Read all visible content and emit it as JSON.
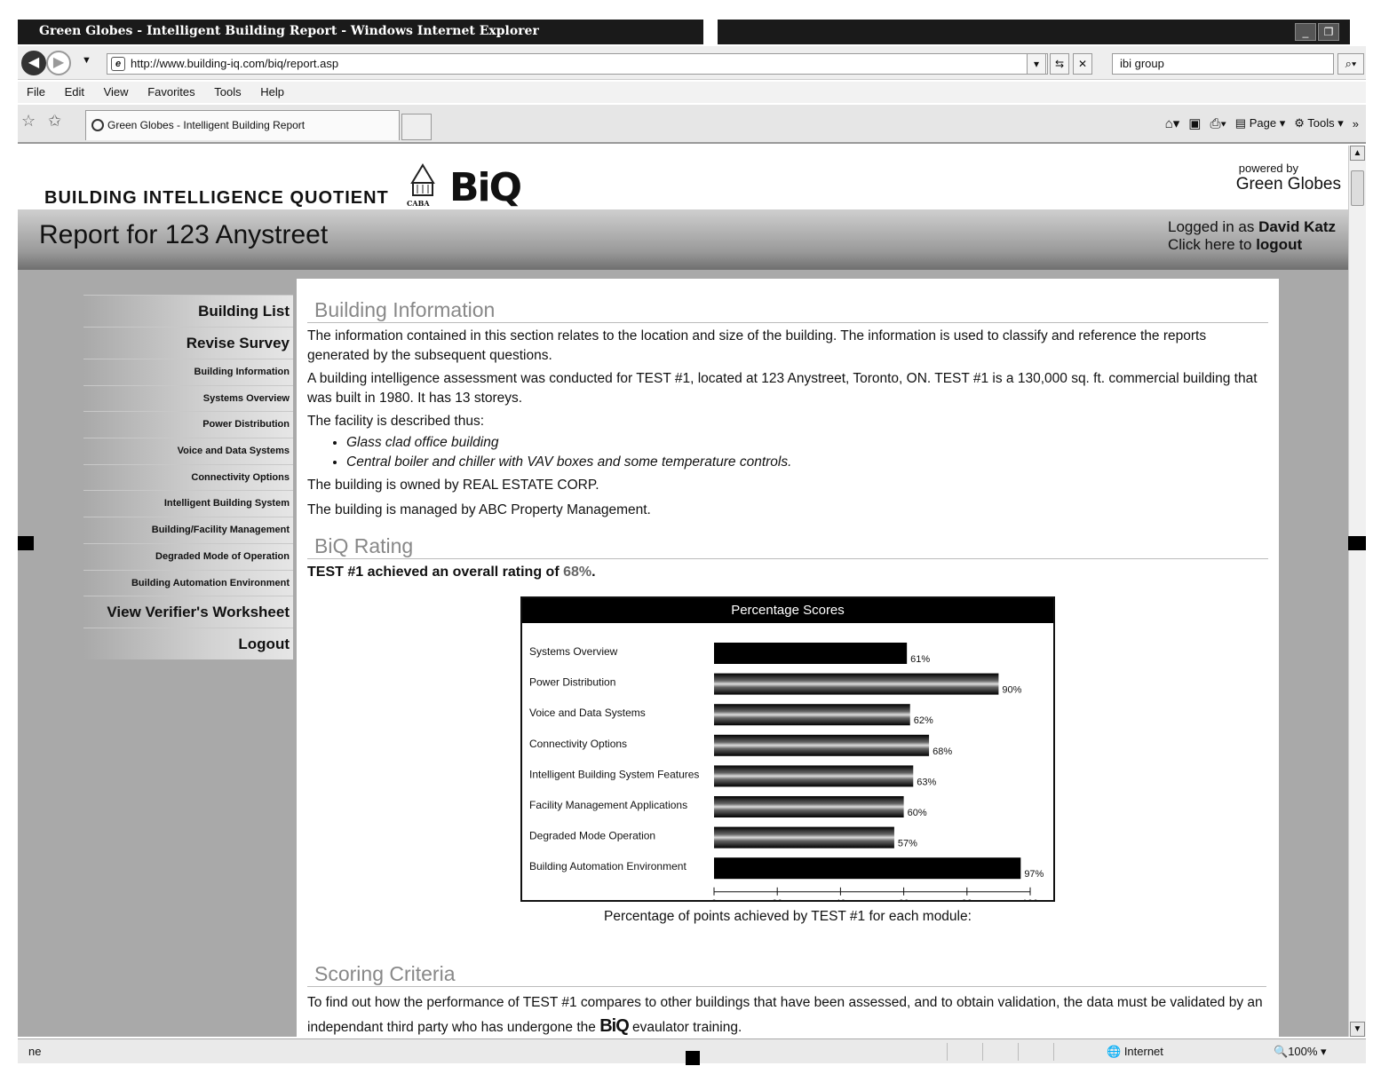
{
  "window": {
    "title": "Green Globes - Intelligent Building Report - Windows Internet Explorer",
    "min_label": "_",
    "max_label": "❐"
  },
  "address": {
    "url": "http://www.building-iq.com/biq/report.asp",
    "search_value": "ibi group"
  },
  "menu": [
    "File",
    "Edit",
    "View",
    "Favorites",
    "Tools",
    "Help"
  ],
  "tab": {
    "label": "Green Globes - Intelligent Building Report"
  },
  "commandbar": {
    "page": "Page",
    "tools": "Tools"
  },
  "brand": {
    "name": "BUILDING INTELLIGENCE QUOTIENT",
    "logo": "BiQ",
    "caba": "CABA",
    "powered_by": "powered by",
    "powered_name": "Green Globes"
  },
  "report": {
    "title": "Report for 123 Anystreet",
    "logged_in_prefix": "Logged in as ",
    "user": "David Katz",
    "logout_prefix": "Click here to ",
    "logout_link": "logout"
  },
  "sidebar": {
    "main_top": [
      "Building List",
      "Revise Survey"
    ],
    "sub": [
      "Building Information",
      "Systems Overview",
      "Power Distribution",
      "Voice and Data Systems",
      "Connectivity Options",
      "Intelligent Building System",
      "Building/Facility Management",
      "Degraded Mode of Operation",
      "Building Automation Environment"
    ],
    "main_bottom": [
      "View Verifier's Worksheet",
      "Logout"
    ]
  },
  "building_info": {
    "heading": "Building Information",
    "p1": "The information contained in this section relates to the location and size of the building. The information is used to classify and reference the reports generated by the subsequent questions.",
    "p2": "A building intelligence assessment was conducted for TEST #1, located at 123 Anystreet, Toronto, ON. TEST #1 is a 130,000 sq. ft. commercial building that was built in 1980. It has 13 storeys.",
    "p3": "The facility is described thus:",
    "bullets": [
      "Glass clad office building",
      "Central boiler and chiller with VAV boxes and some temperature controls."
    ],
    "owner": "The building is owned by REAL ESTATE CORP.",
    "manager": "The building is managed by ABC Property Management."
  },
  "biq_rating": {
    "heading": "BiQ Rating",
    "summary_prefix": "TEST #1 achieved an overall rating of ",
    "summary_pct": "68%",
    "summary_suffix": ".",
    "caption": "Percentage of points achieved by TEST #1 for each module:"
  },
  "chart_data": {
    "type": "bar",
    "orientation": "horizontal",
    "title": "Percentage Scores",
    "categories": [
      "Systems Overview",
      "Power Distribution",
      "Voice and Data Systems",
      "Connectivity Options",
      "Intelligent Building System Features",
      "Facility Management Applications",
      "Degraded Mode Operation",
      "Building Automation Environment"
    ],
    "values": [
      61,
      90,
      62,
      68,
      63,
      60,
      57,
      97
    ],
    "value_labels": [
      "61%",
      "90%",
      "62%",
      "68%",
      "63%",
      "60%",
      "57%",
      "97%"
    ],
    "xlim": [
      0,
      100
    ],
    "xticks": [
      0,
      20,
      40,
      60,
      80,
      100
    ],
    "xlabel": "",
    "ylabel": ""
  },
  "scoring": {
    "heading": "Scoring Criteria",
    "text_before": "To find out how the performance of TEST #1 compares to other buildings that have been assessed, and to obtain validation, the data must be validated by an independant third party who has undergone the ",
    "logo": "BiQ",
    "text_after": " evaulator training."
  },
  "status": {
    "left": "ne",
    "zone": "Internet",
    "zoom": "100%"
  }
}
